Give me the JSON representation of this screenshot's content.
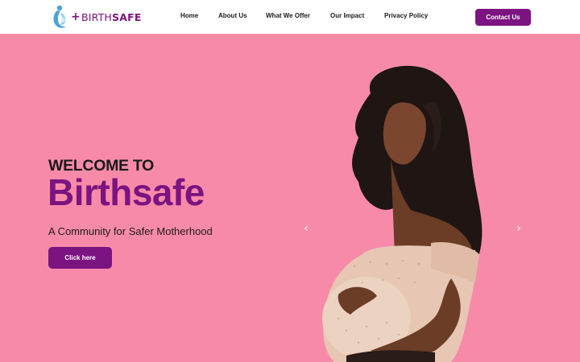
{
  "brand": {
    "plus": "+",
    "birth": "BIRTH",
    "safe": "SAFE",
    "logo_icon": "mother-baby-logo-icon"
  },
  "nav": {
    "items": [
      {
        "label": "Home"
      },
      {
        "label": "About Us"
      },
      {
        "label": "What We Offer"
      },
      {
        "label": "Our Impact"
      },
      {
        "label": "Privacy Policy"
      }
    ],
    "contact_label": "Contact Us"
  },
  "hero": {
    "eyebrow": "WELCOME TO",
    "title": "Birthsafe",
    "tagline": "A Community for Safer Motherhood",
    "cta_label": "Click here",
    "prev_icon": "chevron-left-icon",
    "next_icon": "chevron-right-icon",
    "image": "pregnant-woman-photo"
  },
  "colors": {
    "accent": "#7b1380",
    "background": "#f88aa9",
    "header": "#ffffff",
    "text": "#1a1a1a"
  }
}
